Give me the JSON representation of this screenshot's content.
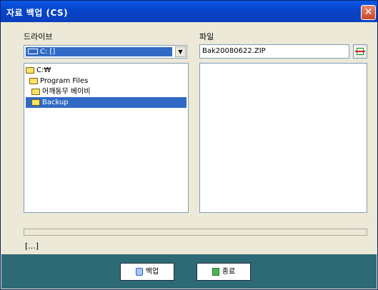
{
  "window": {
    "title": "자료 백업 (CS)",
    "close_label": "✕"
  },
  "drive": {
    "label": "드라이브",
    "selected": "C: []",
    "arrow": "▼"
  },
  "file": {
    "label": "파일",
    "value": "Bak20080622.ZIP"
  },
  "tree": {
    "items": [
      {
        "label": "C:₩"
      },
      {
        "label": "Program Files"
      },
      {
        "label": "어깨동무 베이비"
      },
      {
        "label": "Backup"
      }
    ]
  },
  "status": {
    "text": "[...]"
  },
  "buttons": {
    "backup_label": "백업",
    "exit_label": "종료"
  },
  "icons": [
    "drive-icon",
    "folder-icon",
    "file-browse-icon",
    "backup-icon",
    "exit-icon",
    "close-icon"
  ],
  "colors": {
    "titlebar": "#0a58e8",
    "selection": "#316ac5",
    "footer": "#2e6a76"
  }
}
